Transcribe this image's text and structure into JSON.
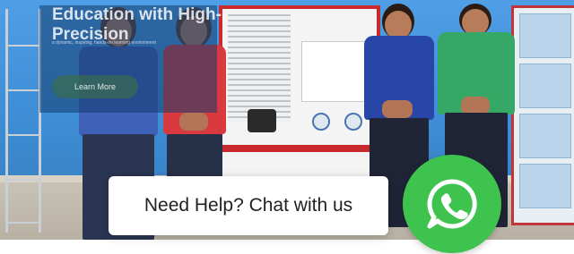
{
  "hero": {
    "title": "Education with High-Precision",
    "subtitle": "a dynamic, inspiring, hands-on learning environment",
    "learn_more_label": "Learn More"
  },
  "help_widget": {
    "label": "Need Help? Chat with us"
  },
  "whatsapp_button": {
    "icon": "whatsapp-icon",
    "color": "#3ec34e"
  },
  "colors": {
    "wall": "#4f9ee6",
    "trainer_frame": "#c82a30",
    "whatsapp_green": "#3ec34e"
  }
}
